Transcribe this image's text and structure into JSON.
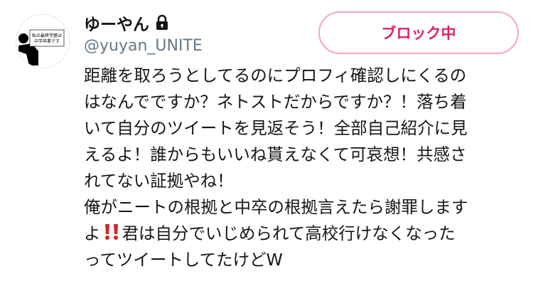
{
  "user": {
    "display_name": "ゆーやん",
    "handle": "@yuyan_UNITE",
    "protected_icon": "lock-icon",
    "avatar": {
      "text_lines": [
        "私の最終学歴は",
        "中学卒業です"
      ]
    }
  },
  "actions": {
    "block_label": "ブロック中",
    "accent_color": "#e0245e"
  },
  "tweet": {
    "lines": [
      "距離を取ろうとしてるのにプロフィ確認しにくるの",
      "はなんでですか？ネトストだからですか？！落ち着",
      "いて自分のツイートを見返そう！全部自己紹介に見",
      "えるよ！誰からもいいね貰えなくて可哀想！共感さ",
      "れてない証拠やね！",
      "俺がニートの根拠と中卒の根拠言えたら謝罪します"
    ],
    "line_with_emoji": {
      "before": "よ",
      "emoji": "double-exclamation-emoji",
      "after": "君は自分でいじめられて高校行けなくなった"
    },
    "last_line": "ってツイートしてたけどW"
  }
}
